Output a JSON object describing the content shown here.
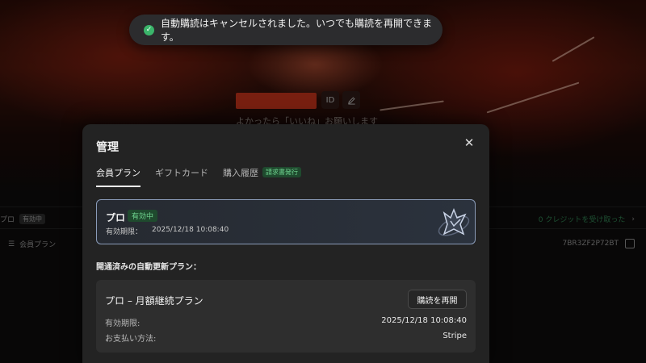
{
  "toast": {
    "icon": "check-circle-icon",
    "message": "自動購読はキャンセルされました。いつでも購読を再開できます。"
  },
  "profile": {
    "id_label": "ID",
    "bio": "よかったら「いいね」お願いします"
  },
  "background_rows": {
    "row1": {
      "label": "プロ",
      "badge": "有効中",
      "credit_link": "0 クレジットを受け取った"
    },
    "row2": {
      "label": "会員プラン",
      "code": "7BR3ZF2P72BT"
    }
  },
  "modal": {
    "title": "管理",
    "close_icon": "close-icon",
    "tabs": [
      {
        "label": "会員プラン",
        "active": true
      },
      {
        "label": "ギフトカード",
        "active": false
      },
      {
        "label": "購入履歴",
        "active": false,
        "badge": "請求書発行"
      }
    ],
    "current_plan": {
      "name": "プロ",
      "status": "有効中",
      "expiry_label": "有効期限：",
      "expiry_value": "2025/12/18 10:08:40"
    },
    "section_label": "開通済みの自動更新プラン：",
    "renewal_plan": {
      "title": "プロ – 月額継続プラン",
      "resume_button": "購読を再開",
      "expiry_label": "有効期限:",
      "expiry_value": "2025/12/18 10:08:40",
      "payment_label": "お支払い方法:",
      "payment_value": "Stripe"
    }
  },
  "colors": {
    "accent_green": "#3bb56b",
    "badge_green_text": "#6fd38f",
    "name_highlight": "#b8301a"
  }
}
